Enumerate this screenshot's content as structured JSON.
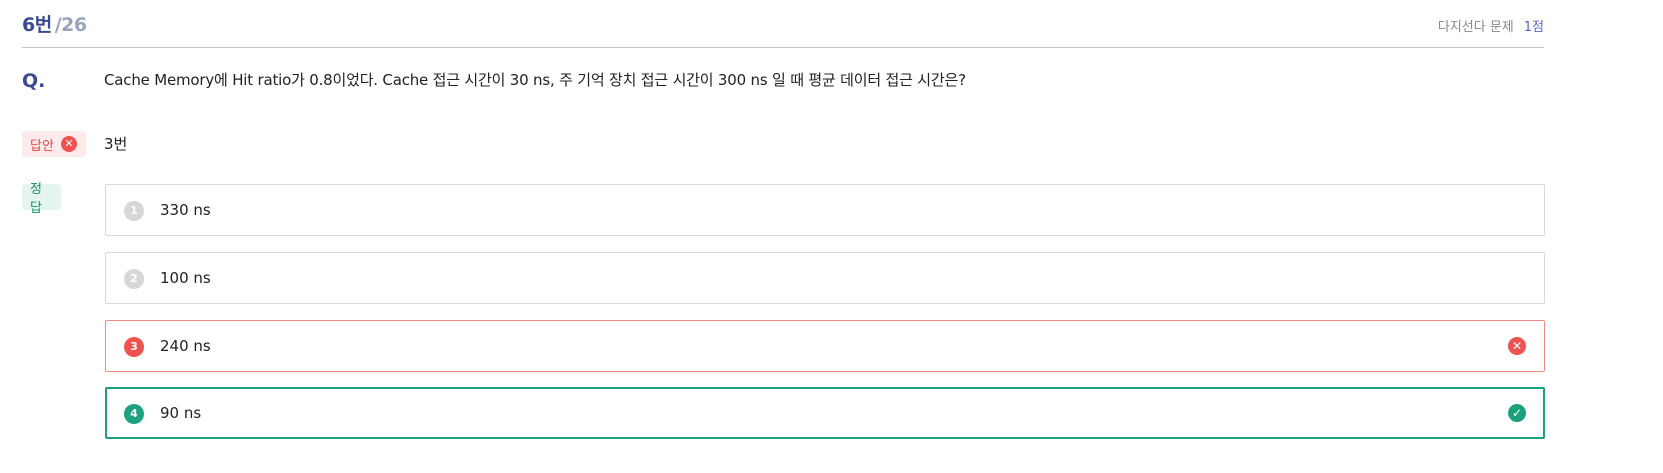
{
  "header": {
    "question_number": "6번",
    "total": "/26",
    "question_type": "다지선다 문제",
    "points": "1점"
  },
  "question": {
    "label": "Q.",
    "text": "Cache Memory에 Hit ratio가 0.8이었다. Cache 접근 시간이 30 ns, 주 기억 장치 접근 시간이 300 ns 일 때 평균 데이터 접근 시간은?"
  },
  "answer": {
    "label": "답안",
    "value": "3번",
    "status_icon": "x-circle-icon"
  },
  "correct": {
    "label": "정답"
  },
  "options": [
    {
      "number": "1",
      "text": "330 ns",
      "state": "neutral"
    },
    {
      "number": "2",
      "text": "100 ns",
      "state": "neutral"
    },
    {
      "number": "3",
      "text": "240 ns",
      "state": "wrong",
      "icon": "x-circle-icon"
    },
    {
      "number": "4",
      "text": "90 ns",
      "state": "correct",
      "icon": "check-circle-icon"
    }
  ],
  "colors": {
    "accent": "#3a4a8c",
    "wrong": "#ef5350",
    "correct": "#1ba27c"
  }
}
